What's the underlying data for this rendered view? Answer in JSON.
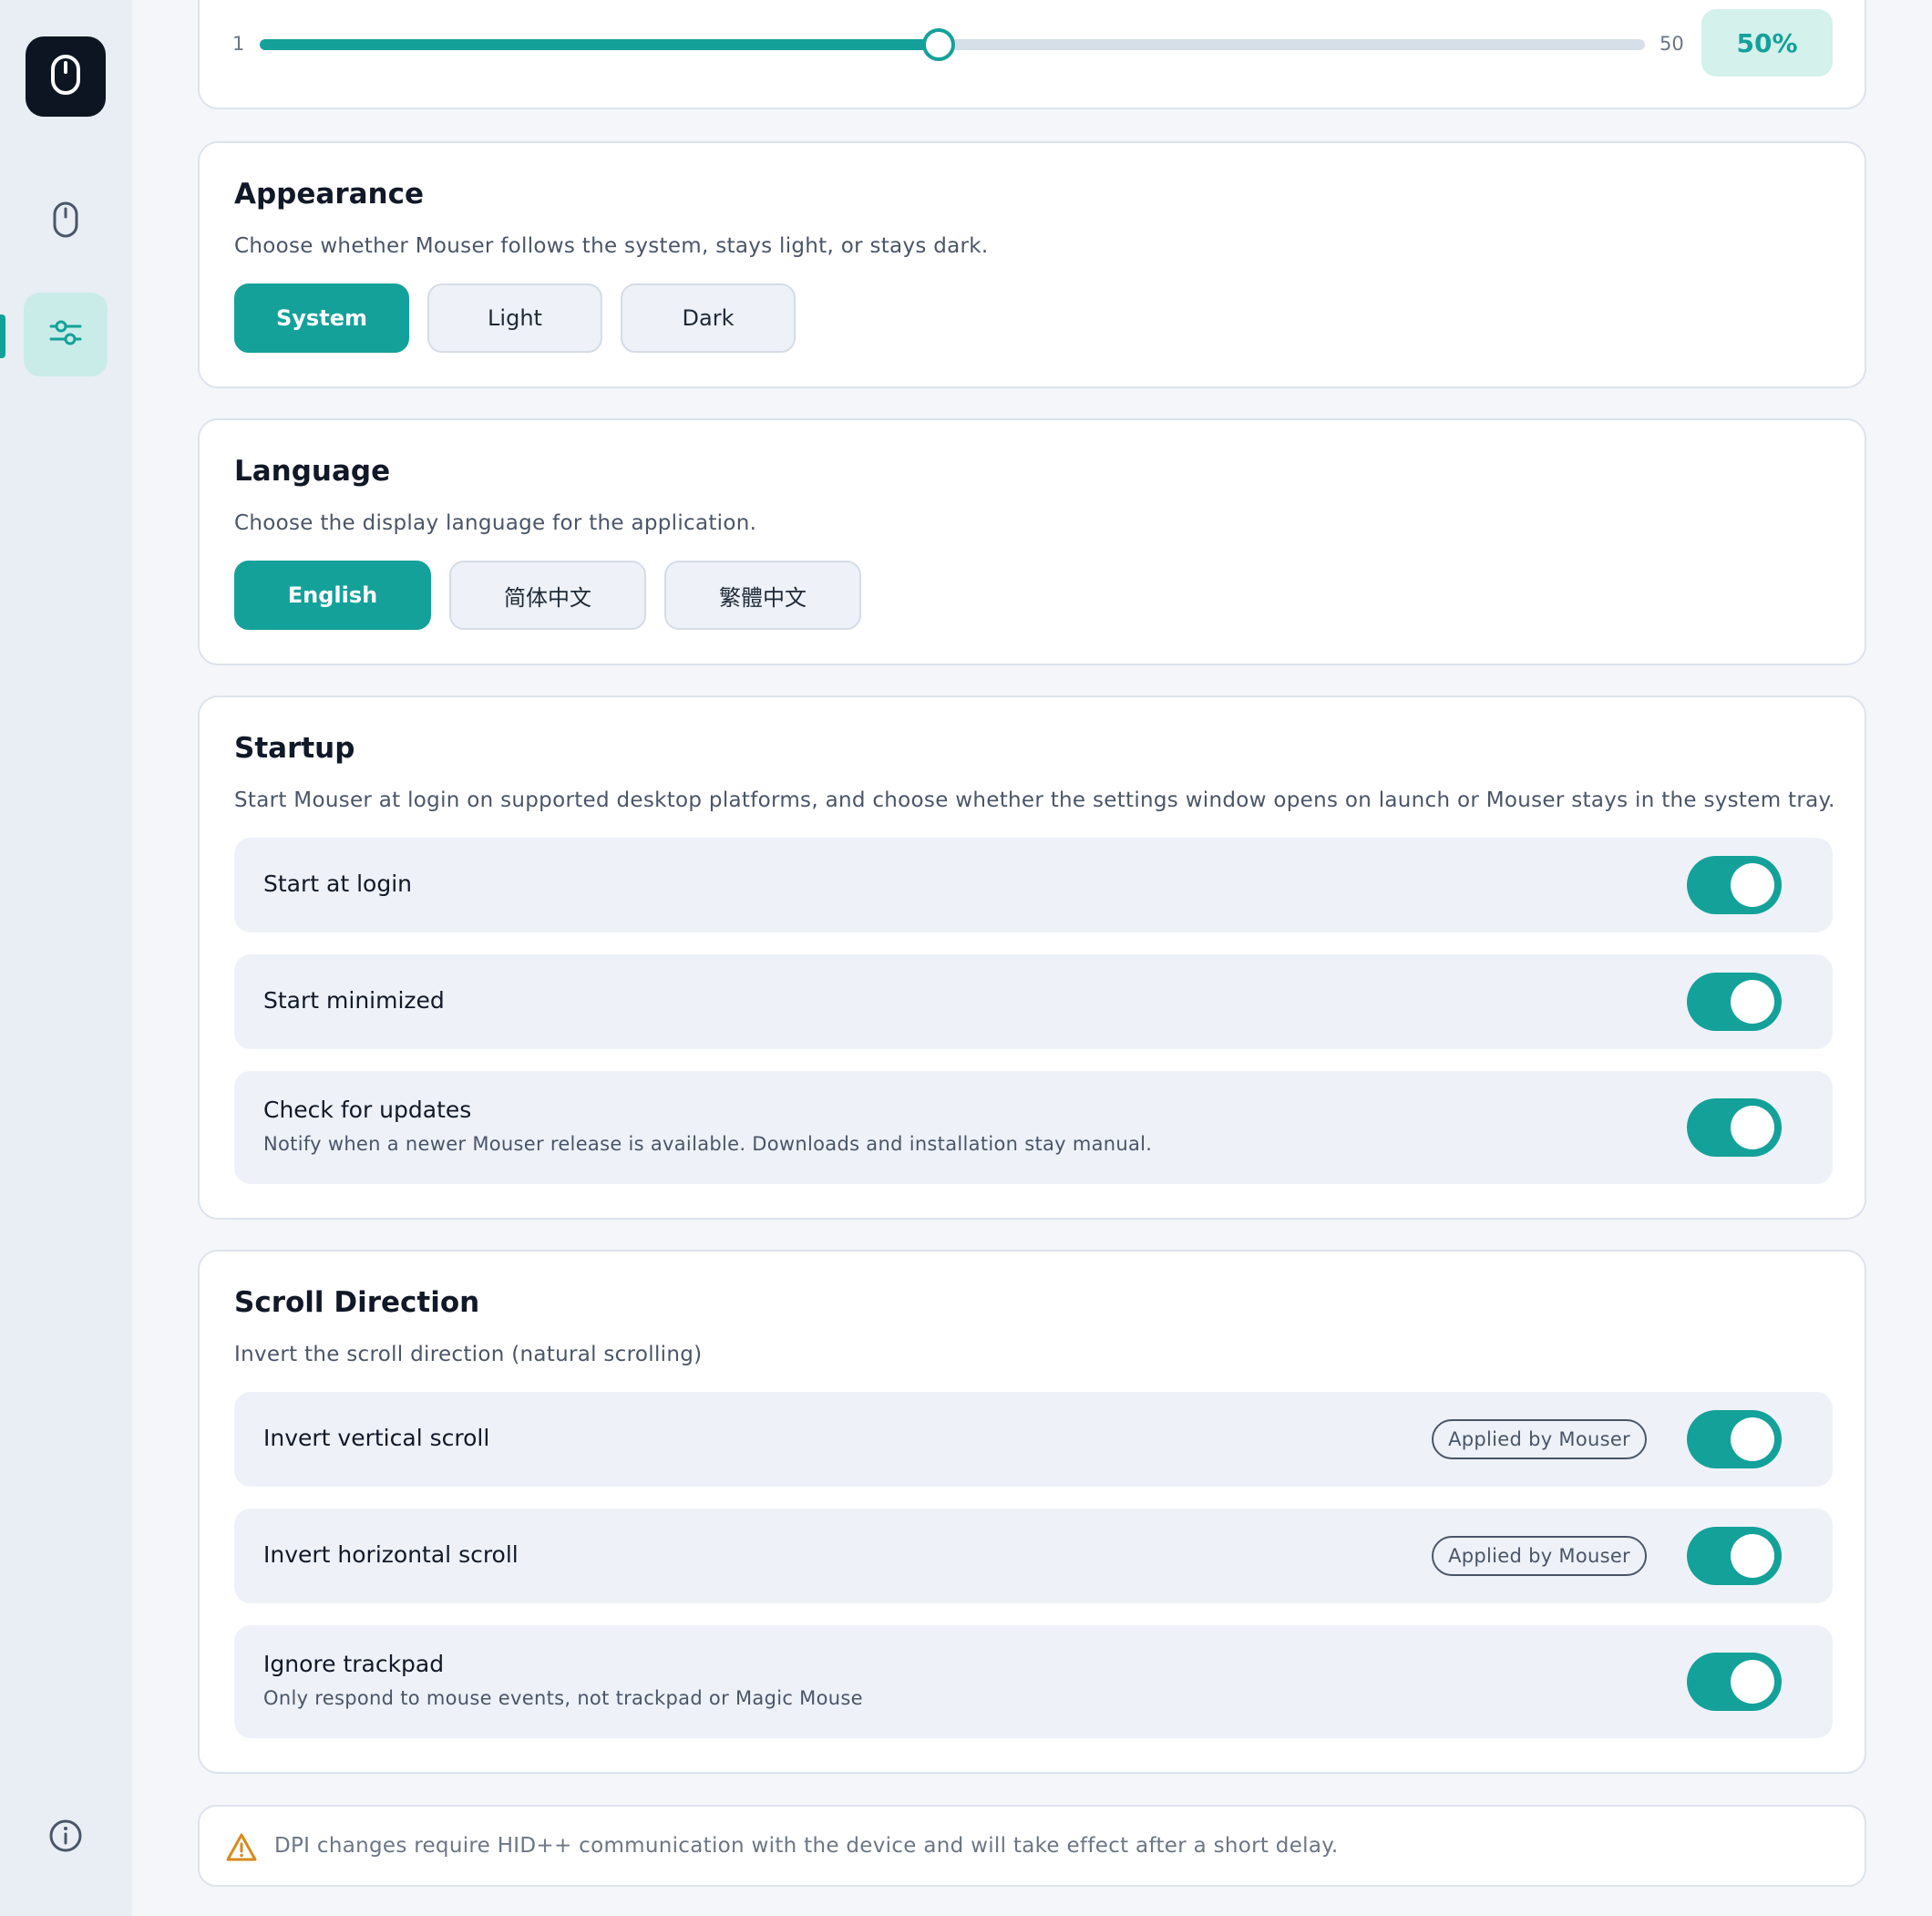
{
  "sidebar": {
    "logo_icon": "mouse-icon",
    "items": [
      {
        "id": "devices",
        "icon": "mouse-icon",
        "active": false
      },
      {
        "id": "settings",
        "icon": "sliders-icon",
        "active": true
      }
    ],
    "info_icon": "info-icon",
    "accent_color": "#14a19a"
  },
  "slider": {
    "min_label": "1",
    "max_label": "50",
    "value_label": "50%",
    "fill_fraction": 0.49
  },
  "appearance": {
    "title": "Appearance",
    "description": "Choose whether Mouser follows the system, stays light, or stays dark.",
    "options": [
      "System",
      "Light",
      "Dark"
    ],
    "selected": "System"
  },
  "language": {
    "title": "Language",
    "description": "Choose the display language for the application.",
    "options": [
      "English",
      "简体中文",
      "繁體中文"
    ],
    "selected": "English"
  },
  "startup": {
    "title": "Startup",
    "description": "Start Mouser at login on supported desktop platforms, and choose whether the settings window opens on launch or Mouser stays in the system tray.",
    "rows": [
      {
        "label": "Start at login",
        "enabled": true
      },
      {
        "label": "Start minimized",
        "enabled": true
      },
      {
        "label": "Check for updates",
        "sublabel": "Notify when a newer Mouser release is available. Downloads and installation stay manual.",
        "enabled": true
      }
    ]
  },
  "scroll": {
    "title": "Scroll Direction",
    "description": "Invert the scroll direction (natural scrolling)",
    "rows": [
      {
        "label": "Invert vertical scroll",
        "badge": "Applied by Mouser",
        "enabled": true
      },
      {
        "label": "Invert horizontal scroll",
        "badge": "Applied by Mouser",
        "enabled": true
      },
      {
        "label": "Ignore trackpad",
        "sublabel": "Only respond to mouse events, not trackpad or Magic Mouse",
        "enabled": true
      }
    ]
  },
  "note": {
    "icon": "warning-icon",
    "text": "DPI changes require HID++ communication with the device and will take effect after a short delay."
  }
}
